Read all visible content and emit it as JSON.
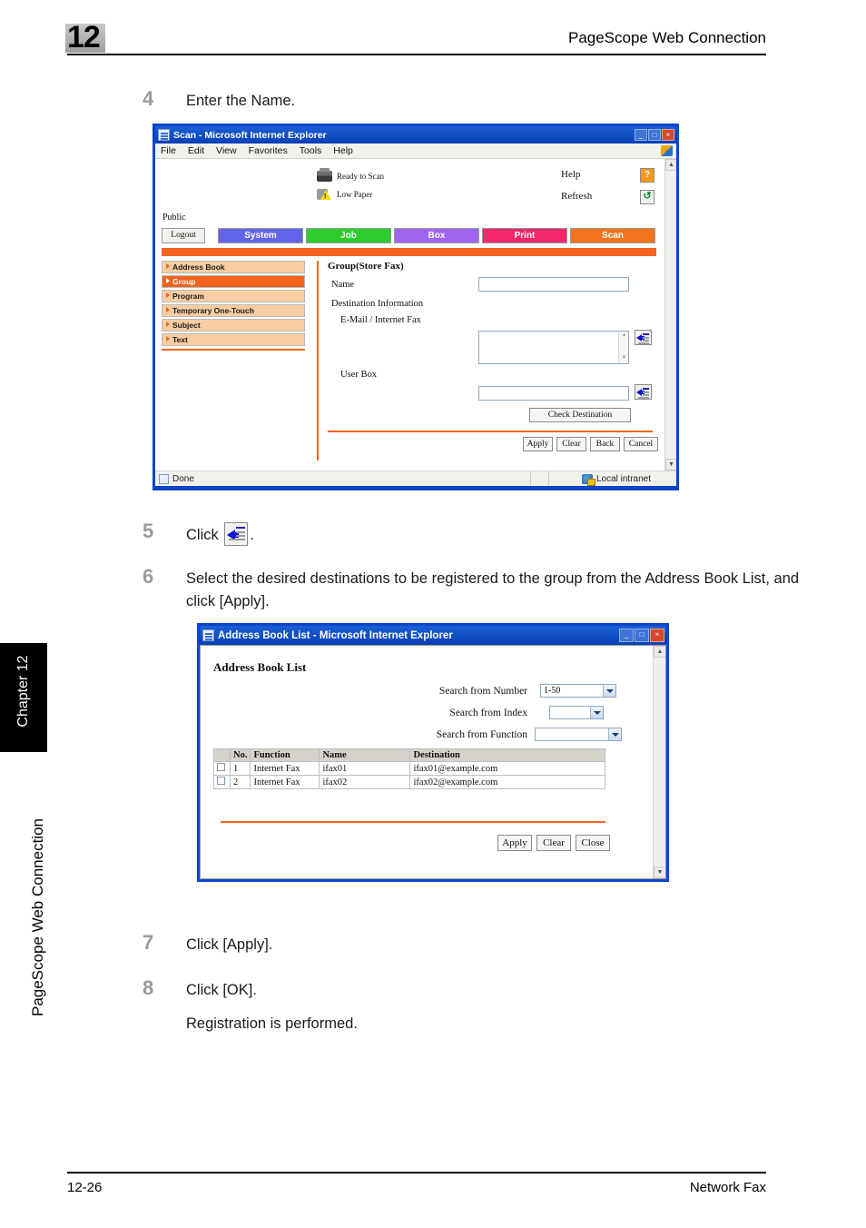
{
  "page_header": {
    "chapter_number": "12",
    "title": "PageScope Web Connection"
  },
  "side_tabs": {
    "chapter_tab": "Chapter 12",
    "book_title": "PageScope Web Connection"
  },
  "steps": [
    {
      "num": "4",
      "text": "Enter the Name."
    },
    {
      "num": "5",
      "text_before": "Click",
      "icon": "address-book-icon",
      "text_after": "."
    },
    {
      "num": "6",
      "text": "Select the desired destinations to be registered to the group from the Address Book List, and click [Apply]."
    },
    {
      "num": "7",
      "text": "Click [Apply]."
    },
    {
      "num": "8",
      "text": "Click [OK].",
      "sub": "Registration is performed."
    }
  ],
  "scan_window": {
    "title": "Scan - Microsoft Internet Explorer",
    "title_icon": "ie-page-icon",
    "window_buttons": {
      "minimize": "_",
      "maximize": "□",
      "close": "×"
    },
    "menu": [
      {
        "label": "File",
        "accel": "F",
        "rest": "ile"
      },
      {
        "label": "Edit",
        "accel": "E",
        "rest": "dit"
      },
      {
        "label": "View",
        "accel": "V",
        "rest": "iew"
      },
      {
        "label": "Favorites",
        "accel": "a",
        "pre": "F",
        "rest": "vorites"
      },
      {
        "label": "Tools",
        "accel": "T",
        "rest": "ools"
      },
      {
        "label": "Help",
        "accel": "H",
        "rest": "elp"
      }
    ],
    "flag_icon": "windows-flag-icon",
    "status": [
      {
        "icon": "printer-icon",
        "label": "Ready to Scan"
      },
      {
        "icon": "low-paper-warning-icon",
        "label": "Low Paper"
      }
    ],
    "help_label": "Help",
    "help_icon": "question-mark-icon",
    "refresh_label": "Refresh",
    "refresh_icon": "refresh-arrows-icon",
    "user_label": "Public",
    "logout_label": "Logout",
    "tabs": [
      {
        "label": "System",
        "color": "#6164e8"
      },
      {
        "label": "Job",
        "color": "#2ecc2e"
      },
      {
        "label": "Box",
        "color": "#a065f0"
      },
      {
        "label": "Print",
        "color": "#f5256c"
      },
      {
        "label": "Scan",
        "color": "#f4741e"
      }
    ],
    "sidebar": [
      {
        "label": "Address Book",
        "active": false
      },
      {
        "label": "Group",
        "active": true
      },
      {
        "label": "Program",
        "active": false
      },
      {
        "label": "Temporary One-Touch",
        "active": false
      },
      {
        "label": "Subject",
        "active": false
      },
      {
        "label": "Text",
        "active": false
      }
    ],
    "form": {
      "title": "Group(Store Fax)",
      "name_label": "Name",
      "name_value": "",
      "destination_label": "Destination Information",
      "email_label": "E-Mail / Internet Fax",
      "email_value": "",
      "userbox_label": "User Box",
      "userbox_value": "",
      "email_picker_icon": "address-book-icon",
      "userbox_picker_icon": "address-book-icon",
      "check_destination_label": "Check Destination",
      "buttons": [
        "Apply",
        "Clear",
        "Back",
        "Cancel"
      ]
    },
    "statusbar": {
      "text": "Done",
      "icon": "ie-page-icon",
      "zone": "Local intranet",
      "zone_icon": "globe-icon"
    }
  },
  "address_book_window": {
    "title": "Address Book List - Microsoft Internet Explorer",
    "title_icon": "ie-page-icon",
    "window_buttons": {
      "minimize": "_",
      "maximize": "□",
      "close": "×"
    },
    "heading": "Address Book List",
    "search_rows": [
      {
        "label": "Search from Number",
        "value": "1-50"
      },
      {
        "label": "Search from Index",
        "value": ""
      },
      {
        "label": "Search from Function",
        "value": ""
      }
    ],
    "table": {
      "columns": [
        "",
        "No.",
        "Function",
        "Name",
        "Destination"
      ],
      "rows": [
        {
          "checked": false,
          "no": "1",
          "function": "Internet Fax",
          "name": "ifax01",
          "destination": "ifax01@example.com"
        },
        {
          "checked": false,
          "no": "2",
          "function": "Internet Fax",
          "name": "ifax02",
          "destination": "ifax02@example.com"
        }
      ]
    },
    "buttons": [
      "Apply",
      "Clear",
      "Close"
    ]
  },
  "footer": {
    "page_number": "12-26",
    "section": "Network Fax"
  },
  "colors": {
    "accent_orange": "#f4641e",
    "sidebar_item": "#f9cda2",
    "ie_blue": "#0a46c8",
    "step_number_gray": "#9a9a9a"
  }
}
